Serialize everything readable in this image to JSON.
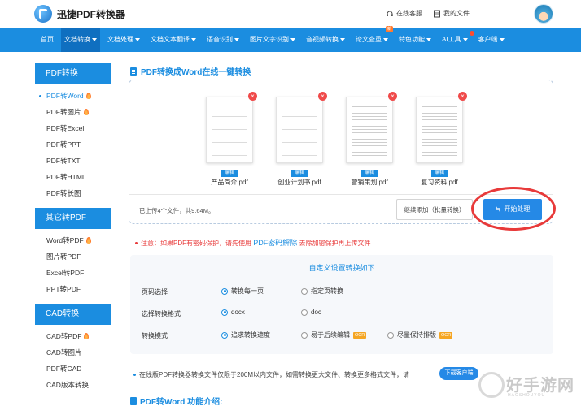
{
  "header": {
    "brand": "迅捷PDF转换器",
    "service_link": "在线客服",
    "files_link": "我的文件"
  },
  "nav": {
    "items": [
      {
        "label": "首页",
        "caret": false
      },
      {
        "label": "文档转换",
        "caret": true
      },
      {
        "label": "文档处理",
        "caret": true
      },
      {
        "label": "文档文本翻译",
        "caret": true
      },
      {
        "label": "语音识别",
        "caret": true
      },
      {
        "label": "图片文字识别",
        "caret": true
      },
      {
        "label": "音视频转换",
        "caret": true
      },
      {
        "label": "论文查重",
        "caret": true
      },
      {
        "label": "特色功能",
        "caret": true
      },
      {
        "label": "AI工具",
        "caret": true
      },
      {
        "label": "客户端",
        "caret": true
      }
    ],
    "active_index": 1,
    "badge_text": "新"
  },
  "sidebar": {
    "groups": [
      {
        "title": "PDF转换",
        "items": [
          {
            "label": "PDF转Word",
            "hot": true,
            "active": true
          },
          {
            "label": "PDF转图片",
            "hot": true
          },
          {
            "label": "PDF转Excel"
          },
          {
            "label": "PDF转PPT"
          },
          {
            "label": "PDF转TXT"
          },
          {
            "label": "PDF转HTML"
          },
          {
            "label": "PDF转长图"
          }
        ]
      },
      {
        "title": "其它转PDF",
        "items": [
          {
            "label": "Word转PDF",
            "hot": true
          },
          {
            "label": "图片转PDF"
          },
          {
            "label": "Excel转PDF"
          },
          {
            "label": "PPT转PDF"
          }
        ]
      },
      {
        "title": "CAD转换",
        "items": [
          {
            "label": "CAD转PDF",
            "hot": true
          },
          {
            "label": "CAD转图片"
          },
          {
            "label": "PDF转CAD"
          },
          {
            "label": "CAD版本转换"
          }
        ]
      }
    ]
  },
  "main": {
    "title": "PDF转换成Word在线一键转换",
    "files": [
      {
        "name": "产品简介.pdf",
        "edit": "编辑"
      },
      {
        "name": "创业计划书.pdf",
        "edit": "编辑"
      },
      {
        "name": "营销策划.pdf",
        "edit": "编辑"
      },
      {
        "name": "复习资料.pdf",
        "edit": "编辑"
      }
    ],
    "upload_info": "已上传4个文件，共9.64M。",
    "add_button": "继续添加（批量转换）",
    "start_button": "开始处理"
  },
  "notice": {
    "prefix": "注意：如果PDF有密码保护，请先使用",
    "link": "PDF密码解除",
    "suffix": "去除加密保护再上传文件"
  },
  "settings": {
    "title": "自定义设置转换如下",
    "rows": [
      {
        "label": "页码选择",
        "options": [
          {
            "text": "转换每一页",
            "on": true
          },
          {
            "text": "指定页转换",
            "on": false
          }
        ]
      },
      {
        "label": "选择转换格式",
        "options": [
          {
            "text": "docx",
            "on": true
          },
          {
            "text": "doc",
            "on": false
          }
        ]
      },
      {
        "label": "转换模式",
        "options": [
          {
            "text": "追求转换速度",
            "on": true
          },
          {
            "text": "易于后续编辑",
            "on": false,
            "ocr": "OCR"
          },
          {
            "text": "尽量保持排版",
            "on": false,
            "ocr": "OCR"
          }
        ]
      }
    ]
  },
  "tip": {
    "text": "在线版PDF转换器转换文件仅限于200M以内文件，如需转换更大文件、转换更多格式文件，请",
    "button": "下载客户端"
  },
  "intro_title": "PDF转Word 功能介绍:",
  "watermark": {
    "text": "好手游网",
    "sub": "HAOSHOUYOU"
  }
}
